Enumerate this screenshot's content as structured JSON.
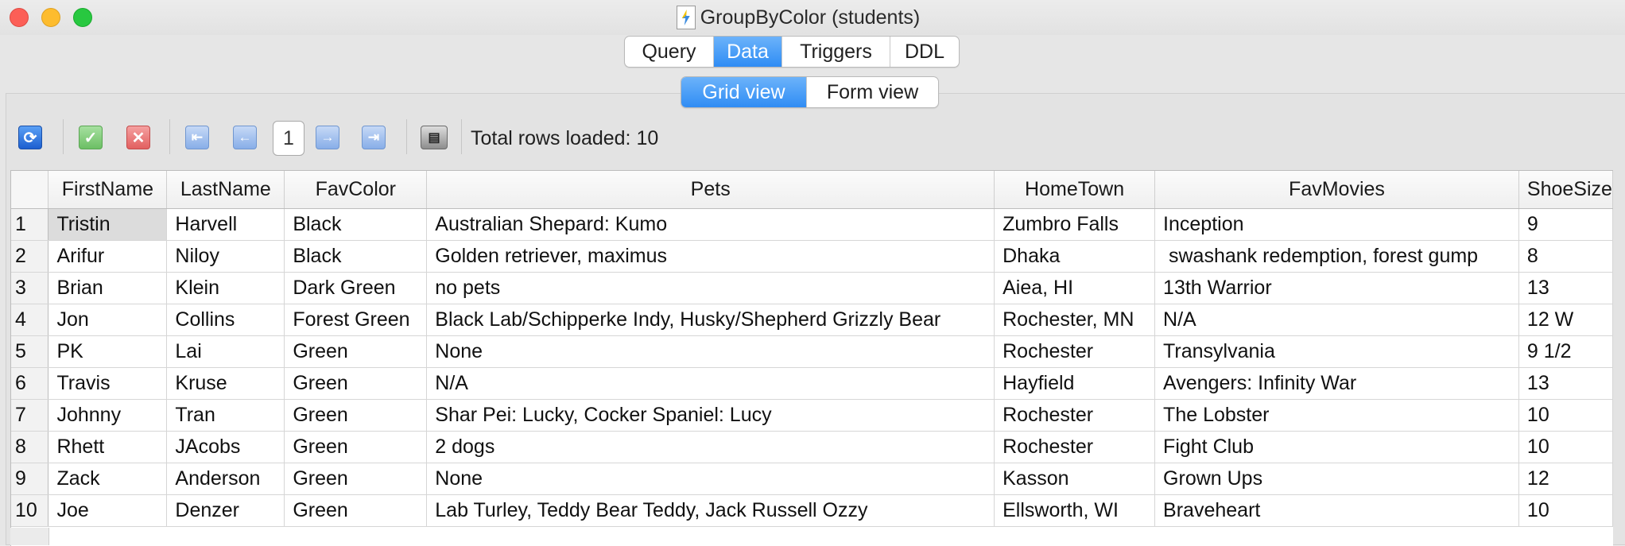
{
  "window": {
    "title": "GroupByColor (students)"
  },
  "top_tabs": [
    {
      "label": "Query",
      "active": false
    },
    {
      "label": "Data",
      "active": true
    },
    {
      "label": "Triggers",
      "active": false
    },
    {
      "label": "DDL",
      "active": false
    }
  ],
  "view_tabs": [
    {
      "label": "Grid view",
      "active": true
    },
    {
      "label": "Form view",
      "active": false
    }
  ],
  "toolbar": {
    "page_value": "1",
    "total_rows": "Total rows loaded: 10",
    "icons": [
      "refresh-icon",
      "commit-icon",
      "rollback-icon",
      "first-page-icon",
      "prev-page-icon",
      "next-page-icon",
      "last-page-icon",
      "print-icon"
    ]
  },
  "grid": {
    "columns": [
      "FirstName",
      "LastName",
      "FavColor",
      "Pets",
      "HomeTown",
      "FavMovies",
      "ShoeSize"
    ],
    "rows": [
      {
        "num": "1",
        "cells": [
          "Tristin",
          "Harvell",
          "Black",
          "Australian Shepard: Kumo",
          "Zumbro Falls",
          "Inception",
          "9"
        ]
      },
      {
        "num": "2",
        "cells": [
          "Arifur",
          "Niloy",
          "Black",
          "Golden retriever, maximus",
          "Dhaka",
          " swashank redemption, forest gump",
          "8"
        ]
      },
      {
        "num": "3",
        "cells": [
          "Brian",
          "Klein",
          "Dark Green",
          "no pets",
          "Aiea, HI",
          "13th Warrior",
          "13"
        ]
      },
      {
        "num": "4",
        "cells": [
          "Jon",
          "Collins",
          "Forest Green",
          "Black Lab/Schipperke Indy, Husky/Shepherd Grizzly Bear",
          "Rochester, MN",
          "N/A",
          "12 W"
        ]
      },
      {
        "num": "5",
        "cells": [
          "PK",
          "Lai",
          "Green",
          "None",
          "Rochester",
          "Transylvania",
          "9 1/2"
        ]
      },
      {
        "num": "6",
        "cells": [
          "Travis",
          "Kruse",
          "Green",
          "N/A",
          "Hayfield",
          "Avengers: Infinity War",
          "13"
        ]
      },
      {
        "num": "7",
        "cells": [
          "Johnny",
          "Tran",
          "Green",
          "Shar Pei: Lucky, Cocker Spaniel: Lucy",
          "Rochester",
          "The Lobster",
          "10"
        ]
      },
      {
        "num": "8",
        "cells": [
          "Rhett",
          "JAcobs",
          "Green",
          "2 dogs",
          "Rochester",
          "Fight Club",
          "10"
        ]
      },
      {
        "num": "9",
        "cells": [
          "Zack",
          "Anderson",
          "Green",
          "None",
          "Kasson",
          "Grown Ups",
          "12"
        ]
      },
      {
        "num": "10",
        "cells": [
          "Joe",
          "Denzer",
          "Green",
          "Lab Turley, Teddy Bear Teddy, Jack Russell Ozzy",
          "Ellsworth, WI",
          "Braveheart",
          "10"
        ]
      }
    ]
  },
  "colors": {
    "accent": "#2f8cf4",
    "close": "#fc5f57",
    "minimize": "#fdbc2e",
    "maximize": "#28c840"
  }
}
